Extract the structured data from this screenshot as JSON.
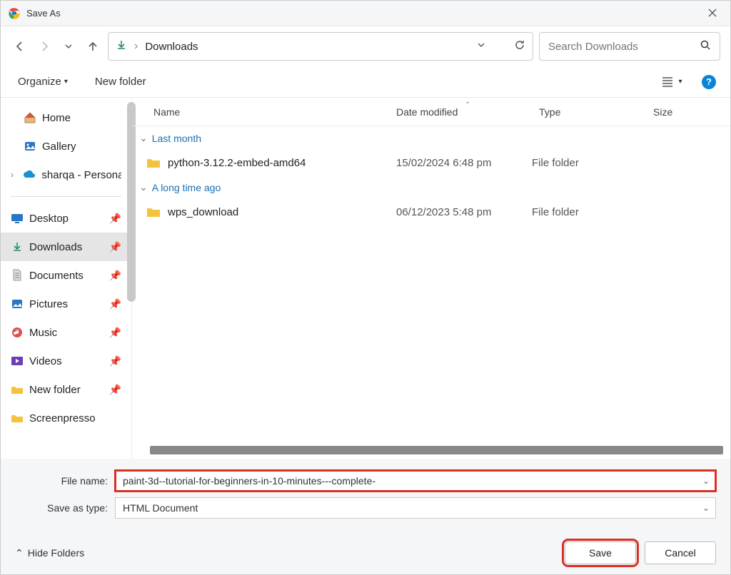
{
  "window": {
    "title": "Save As"
  },
  "breadcrumb": {
    "location": "Downloads"
  },
  "search": {
    "placeholder": "Search Downloads"
  },
  "toolbar": {
    "organize": "Organize",
    "newfolder": "New folder"
  },
  "sidebar": {
    "home": "Home",
    "gallery": "Gallery",
    "cloud": "sharqa - Personal",
    "desktop": "Desktop",
    "downloads": "Downloads",
    "documents": "Documents",
    "pictures": "Pictures",
    "music": "Music",
    "videos": "Videos",
    "newfolder": "New folder",
    "screenpresso": "Screenpresso"
  },
  "columns": {
    "name": "Name",
    "date": "Date modified",
    "type": "Type",
    "size": "Size"
  },
  "groups": {
    "lastmonth": "Last month",
    "longago": "A long time ago"
  },
  "files": [
    {
      "name": "python-3.12.2-embed-amd64",
      "date": "15/02/2024 6:48 pm",
      "type": "File folder"
    },
    {
      "name": "wps_download",
      "date": "06/12/2023 5:48 pm",
      "type": "File folder"
    }
  ],
  "inputs": {
    "filename_label": "File name:",
    "filename_value": "paint-3d--tutorial-for-beginners-in-10-minutes---complete-",
    "savetype_label": "Save as type:",
    "savetype_value": "HTML Document"
  },
  "footer": {
    "hide": "Hide Folders",
    "save": "Save",
    "cancel": "Cancel"
  }
}
